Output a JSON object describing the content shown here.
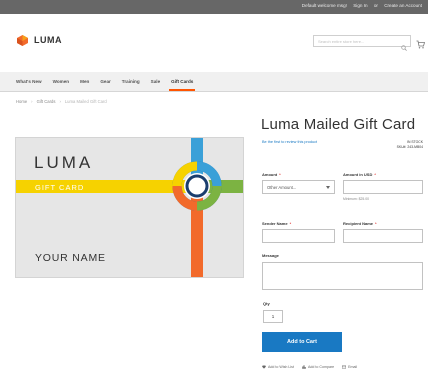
{
  "topbar": {
    "welcome": "Default welcome msg!",
    "sign_in": "Sign In",
    "or": "or",
    "create_account": "Create an Account"
  },
  "header": {
    "logo_text": "LUMA",
    "search_placeholder": "Search entire store here...",
    "icons": {
      "search": "search-icon",
      "cart": "cart-icon"
    }
  },
  "nav": {
    "items": [
      {
        "label": "What's New"
      },
      {
        "label": "Women"
      },
      {
        "label": "Men"
      },
      {
        "label": "Gear"
      },
      {
        "label": "Training"
      },
      {
        "label": "Sale"
      },
      {
        "label": "Gift Cards"
      }
    ],
    "active_index": 6
  },
  "breadcrumbs": {
    "home": "Home",
    "category": "Gift Cards",
    "current": "Luma Mailed Gift Card"
  },
  "gift_card_image": {
    "brand": "LUMA",
    "band_text": "GIFT CARD",
    "name_text": "YOUR NAME"
  },
  "product": {
    "title": "Luma Mailed Gift Card",
    "review_link": "Be the first to review this product",
    "stock": "IN STOCK",
    "sku_label": "SKU#:",
    "sku": "243-MB04"
  },
  "form": {
    "amount_label": "Amount",
    "amount_value": "Other Amount...",
    "amount_usd_label": "Amount in USD",
    "amount_note": "Minimum: $25.00",
    "sender_label": "Sender Name",
    "recipient_label": "Recipient Name",
    "message_label": "Message",
    "qty_label": "Qty",
    "qty_value": "1",
    "add_to_cart": "Add to Cart"
  },
  "actions": {
    "wishlist": "Add to Wish List",
    "compare": "Add to Compare",
    "email": "Email"
  },
  "colors": {
    "accent": "#1979c3",
    "nav_active": "#ff5501",
    "topbar": "#676767",
    "card_yellow": "#f6d200",
    "card_blue": "#3aa0d8",
    "card_green": "#7cb342",
    "card_orange": "#f26a2b",
    "card_darkblue": "#1a62a8"
  }
}
